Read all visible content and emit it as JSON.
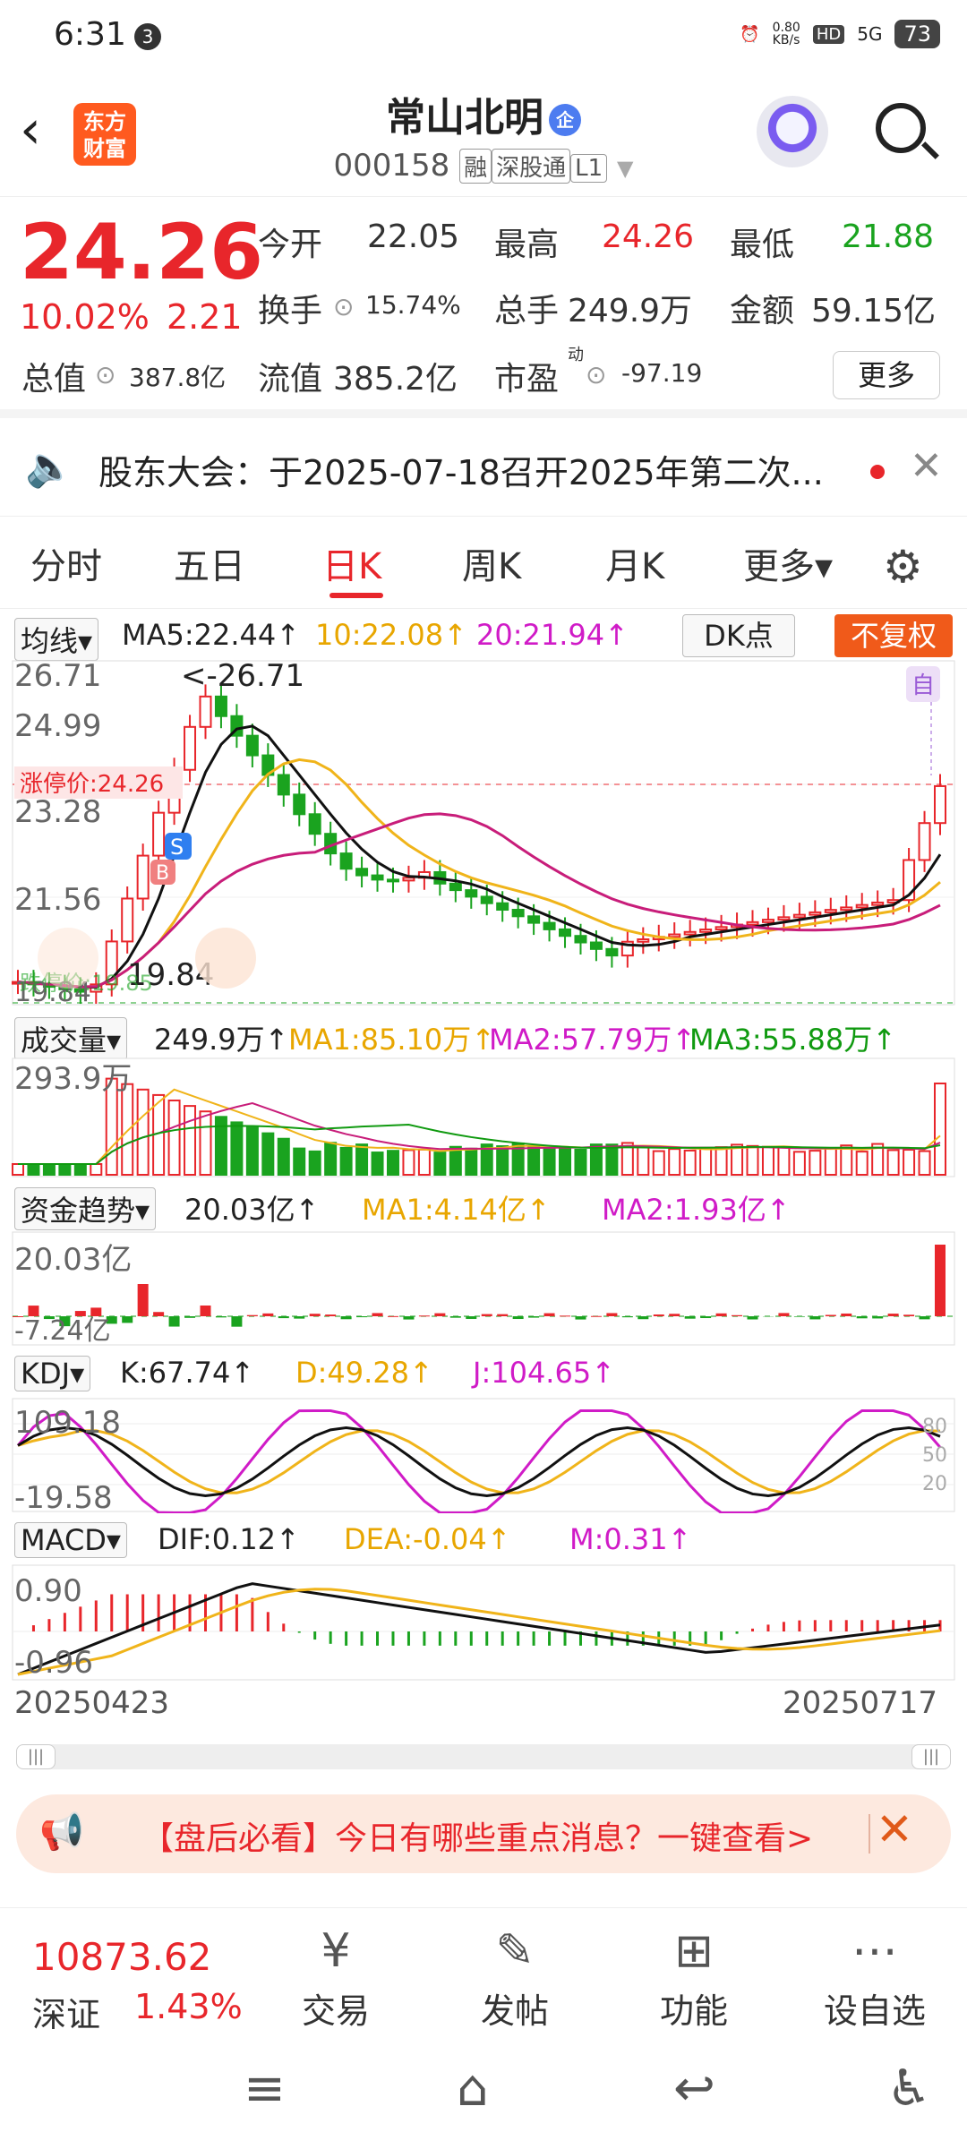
{
  "status_bar": {
    "time": "6:31",
    "notif_count": "3",
    "net_speed": "0.80\nKB/s",
    "hd": "HD",
    "signal": "5G",
    "battery": "73"
  },
  "header": {
    "logo_text": "东方\n财富",
    "stock_name": "常山北明",
    "enterprise_badge": "企",
    "stock_code": "000158",
    "tag_rong": "融",
    "tag_sgt": "深股通",
    "tag_l1": "L1"
  },
  "quote": {
    "price": "24.26",
    "change_pct": "10.02%",
    "change_amt": "2.21",
    "open_label": "今开",
    "open": "22.05",
    "high_label": "最高",
    "high": "24.26",
    "low_label": "最低",
    "low": "21.88",
    "turnover_label": "换手",
    "turnover": "15.74%",
    "volume_label": "总手",
    "volume": "249.9万",
    "amount_label": "金额",
    "amount": "59.15亿",
    "mktcap_label": "总值",
    "mktcap": "387.8亿",
    "float_label": "流值",
    "float_cap": "385.2亿",
    "pe_label": "市盈",
    "pe_sup": "动",
    "pe": "-97.19",
    "more_label": "更多"
  },
  "notice": {
    "text": "股东大会：于2025-07-18召开2025年第二次..."
  },
  "tabs": [
    "分时",
    "五日",
    "日K",
    "周K",
    "月K",
    "更多▾"
  ],
  "active_tab": "日K",
  "ma_row": {
    "selector": "均线▾",
    "ma5": "MA5:22.44↑",
    "ma10": "10:22.08↑",
    "ma20": "20:21.94↑",
    "dk": "DK点",
    "fq": "不复权"
  },
  "kline_labels": {
    "y_ticks": [
      "26.71",
      "24.99",
      "23.28",
      "21.56",
      "19.84"
    ],
    "high_marker": "<-26.71",
    "low_marker": "19.84",
    "limit_up": "涨停价:24.26",
    "limit_down_hint": "跌停价:19.85",
    "self_tag": "自",
    "s_tag": "S",
    "b_tag": "B"
  },
  "volume_row": {
    "selector": "成交量▾",
    "value": "249.9万↑",
    "ma1": "MA1:85.10万↑",
    "ma2": "MA2:57.79万↑",
    "ma3": "MA3:55.88万↑",
    "y_tick": "293.9万"
  },
  "fund_row": {
    "selector": "资金趋势▾",
    "value": "20.03亿↑",
    "ma1": "MA1:4.14亿↑",
    "ma2": "MA2:1.93亿↑",
    "y_top": "20.03亿",
    "y_bottom": "-7.24亿"
  },
  "kdj_row": {
    "selector": "KDJ▾",
    "k": "K:67.74↑",
    "d": "D:49.28↑",
    "j": "J:104.65↑",
    "y_top": "109.18",
    "y_bottom": "-19.58",
    "lvl80": "80",
    "lvl50": "50",
    "lvl20": "20"
  },
  "macd_row": {
    "selector": "MACD▾",
    "dif": "DIF:0.12↑",
    "dea": "DEA:-0.04↑",
    "m": "M:0.31↑",
    "y_top": "0.90",
    "y_bottom": "-0.96"
  },
  "dates": {
    "start": "20250423",
    "end": "20250717"
  },
  "promo": {
    "text": "【盘后必看】今日有哪些重点消息？一键查看>"
  },
  "bottom_bar": {
    "index_value": "10873.62",
    "index_name": "深证",
    "index_pct": "1.43%",
    "items": [
      "交易",
      "发帖",
      "功能",
      "设自选"
    ]
  },
  "colors": {
    "up": "#e8262b",
    "down": "#1aa31f",
    "accent": "#f05a1a",
    "ma10": "#e8a600",
    "ma20": "#d01bc7"
  },
  "chart_data": {
    "type": "candlestick",
    "x_range": [
      "20250423",
      "20250717"
    ],
    "ylim": [
      19.84,
      26.71
    ],
    "last_close": 24.26,
    "ma5_last": 22.44,
    "ma10_last": 22.08,
    "ma20_last": 21.94,
    "volume_last": "249.9万",
    "kdj": {
      "K": 67.74,
      "D": 49.28,
      "J": 104.65
    },
    "macd": {
      "DIF": 0.12,
      "DEA": -0.04,
      "M": 0.31
    }
  }
}
